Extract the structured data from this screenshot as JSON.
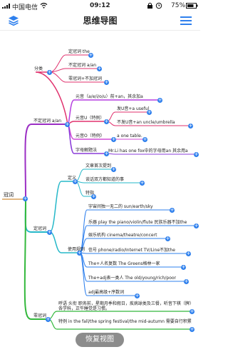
{
  "status_bar": {
    "carrier": "中国电信",
    "time": "09:12",
    "battery": "75%"
  },
  "nav": {
    "title": "思维导图"
  },
  "mindmap": {
    "root": "冠词",
    "branches": {
      "indefinite": {
        "label": "不定冠词 a/an",
        "fenlei": {
          "label": "分类",
          "items": [
            "定冠词 the",
            "不定冠词 a/an",
            "零冠词+不加冠词"
          ]
        },
        "usage": {
          "yuanyin": "元音（a/e/i/o/u）前+an，其余加a",
          "yuanyin_u": {
            "label": "元音U（特例）",
            "items": [
              "发U音+a useful",
              "不发U音+an uncle/umbrella"
            ]
          },
          "yuanyin_o": {
            "label": "元音O（特例）",
            "item": "a one table."
          },
          "zimu": {
            "label": "字母解题法",
            "item": "Mr.Li has one fox中的字母用an 其余用a"
          }
        }
      },
      "definite": {
        "label": "定冠词",
        "dingyi": {
          "label": "定义",
          "items": [
            "文章首次提到",
            "谈话双方都知道的事",
            "特指"
          ]
        },
        "guize": {
          "label": "使用规则",
          "items": [
            "宇宙间独一无二的 sun/earth/sky",
            "乐器 play the piano/violin/flute 民族乐器不加the",
            "娱乐机构 cinema/theatre/concert",
            "信号 phone/radio/Internet  TV/Line不加the",
            "The+人名复数 The Greens格林一家",
            "The+adj表一类人 The old/young/rich/poor",
            "adj最高级+序数词"
          ]
        }
      },
      "zero": {
        "label": "零冠词",
        "items": [
          "呼语 头衔 职务前，星期月季和假日，疾病球类及三餐，听音下棋（牌）各学科，正午睡觉是习惯。",
          "特例 in the fall/the spring festival/the mid-autumn 需要自行积累"
        ]
      }
    }
  },
  "restore_button": "恢复视图",
  "colors": {
    "accent": "#2f80ed",
    "branch_indefinite": "#9b2ec4",
    "branch_definite": "#26b8c9",
    "branch_zero": "#33b83c",
    "fenlei_branch": "#e0326e",
    "yuanyin_branch": "#b63fe0"
  },
  "icons": [
    "signal-icon",
    "wifi-icon",
    "lock-icon",
    "alarm-icon",
    "battery-icon",
    "layers-icon",
    "menu-icon",
    "expand-node-icon"
  ]
}
